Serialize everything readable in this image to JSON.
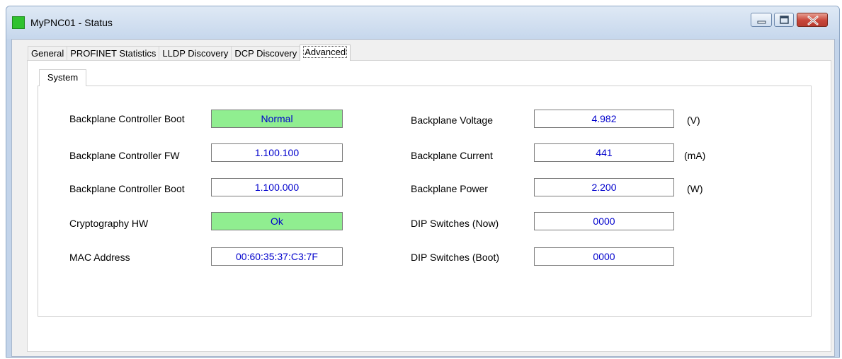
{
  "window": {
    "title": "MyPNC01 - Status",
    "icon": "status-green-square-icon",
    "controls": [
      "minimize-icon",
      "maximize-icon",
      "close-icon"
    ]
  },
  "tabs": [
    "General",
    "PROFINET Statistics",
    "LLDP Discovery",
    "DCP Discovery",
    "Advanced"
  ],
  "active_tab": "Advanced",
  "subtabs": [
    "System"
  ],
  "left": [
    {
      "label": "Backplane Controller Boot",
      "value": "Normal",
      "status": "green"
    },
    {
      "label": "Backplane Controller FW",
      "value": "1.100.100"
    },
    {
      "label": "Backplane Controller Boot",
      "value": "1.100.000"
    },
    {
      "label": "Cryptography HW",
      "value": "Ok",
      "status": "green"
    },
    {
      "label": "MAC Address",
      "value": "00:60:35:37:C3:7F"
    }
  ],
  "right": [
    {
      "label": "Backplane Voltage",
      "value": "4.982",
      "unit": "(V)"
    },
    {
      "label": "Backplane Current",
      "value": "441",
      "unit": "(mA)"
    },
    {
      "label": "Backplane Power",
      "value": "2.200",
      "unit": "(W)"
    },
    {
      "label": "DIP Switches (Now)",
      "value": "0000"
    },
    {
      "label": "DIP Switches (Boot)",
      "value": "0000"
    }
  ],
  "colors": {
    "status_green": "#90ee90",
    "value_text": "#0000cc",
    "titlebar": "#c6d7ec"
  }
}
